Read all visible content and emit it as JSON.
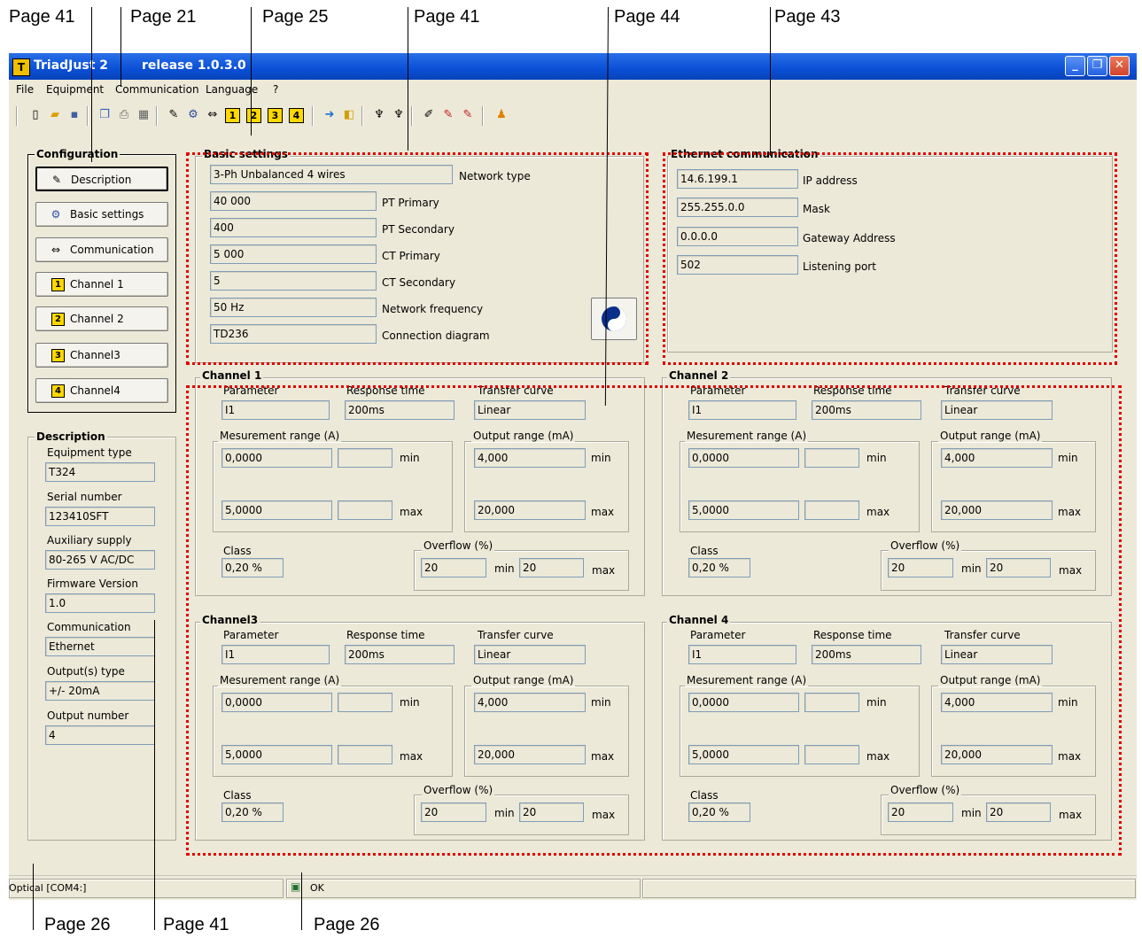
{
  "annotations": {
    "top": [
      "Page 41",
      "Page 21",
      "Page 25",
      "Page 41",
      "Page 44",
      "Page 43"
    ],
    "bottom": [
      "Page 26",
      "Page 41",
      "Page 26"
    ]
  },
  "window": {
    "title": "TriadJust 2",
    "release": "release 1.0.3.0",
    "minimize": "_",
    "restore": "❐",
    "close": "✕"
  },
  "menu": [
    "File",
    "Equipment",
    "Communication",
    "Language",
    "?"
  ],
  "toolbar": {
    "icons": [
      "new-file-icon",
      "open-folder-icon",
      "save-icon",
      "copy-icon",
      "print-icon",
      "print-preview-icon",
      "description-icon",
      "basic-settings-icon",
      "communication-icon",
      "channel-1-icon",
      "channel-2-icon",
      "channel-3-icon",
      "channel-4-icon",
      "download-icon",
      "upload-icon",
      "connect-icon",
      "disconnect-icon",
      "config-icon",
      "read-icon",
      "write-icon",
      "about-icon"
    ],
    "channel_numbers": [
      "1",
      "2",
      "3",
      "4"
    ]
  },
  "configuration": {
    "title": "Configuration",
    "buttons": [
      {
        "label": "Description",
        "icon": "description-icon"
      },
      {
        "label": "Basic settings",
        "icon": "gear-icon"
      },
      {
        "label": "Communication",
        "icon": "arrows-icon"
      },
      {
        "label": "Channel 1",
        "num": "1"
      },
      {
        "label": "Channel 2",
        "num": "2"
      },
      {
        "label": "Channel3",
        "num": "3"
      },
      {
        "label": "Channel4",
        "num": "4"
      }
    ]
  },
  "description": {
    "title": "Description",
    "items": [
      {
        "label": "Equipment type",
        "value": "T324"
      },
      {
        "label": "Serial number",
        "value": "123410SFT"
      },
      {
        "label": "Auxiliary supply",
        "value": "80-265 V AC/DC"
      },
      {
        "label": "Firmware Version",
        "value": "1.0"
      },
      {
        "label": "Communication",
        "value": "Ethernet"
      },
      {
        "label": "Output(s) type",
        "value": "+/- 20mA"
      },
      {
        "label": "Output number",
        "value": "4"
      }
    ]
  },
  "basic_settings": {
    "title": "Basic settings",
    "rows": [
      {
        "value": "3-Ph Unbalanced 4 wires",
        "label": "Network type"
      },
      {
        "value": "40 000",
        "label": "PT Primary"
      },
      {
        "value": "400",
        "label": "PT Secondary"
      },
      {
        "value": "5 000",
        "label": "CT Primary"
      },
      {
        "value": "5",
        "label": "CT Secondary"
      },
      {
        "value": "50 Hz",
        "label": "Network frequency"
      },
      {
        "value": "TD236",
        "label": "Connection diagram"
      }
    ],
    "help_icon": "help-icon"
  },
  "ethernet": {
    "title": "Ethernet communication",
    "rows": [
      {
        "value": "14.6.199.1",
        "label": "IP address"
      },
      {
        "value": "255.255.0.0",
        "label": "Mask"
      },
      {
        "value": "0.0.0.0",
        "label": "Gateway Address"
      },
      {
        "value": "502",
        "label": "Listening port"
      }
    ]
  },
  "channel_labels": {
    "parameter": "Parameter",
    "response_time": "Response time",
    "transfer_curve": "Transfer curve",
    "measurement_range": "Mesurement range (A)",
    "output_range": "Output range (mA)",
    "min": "min",
    "max": "max",
    "class": "Class",
    "overflow": "Overflow (%)"
  },
  "channels": [
    {
      "title": "Channel 1",
      "parameter": "I1",
      "response_time": "200ms",
      "transfer_curve": "Linear",
      "meas_min": "0,0000",
      "meas_max": "5,0000",
      "out_min": "4,000",
      "out_max": "20,000",
      "class": "0,20 %",
      "overflow_min": "20",
      "overflow_max": "20"
    },
    {
      "title": "Channel 2",
      "parameter": "I1",
      "response_time": "200ms",
      "transfer_curve": "Linear",
      "meas_min": "0,0000",
      "meas_max": "5,0000",
      "out_min": "4,000",
      "out_max": "20,000",
      "class": "0,20 %",
      "overflow_min": "20",
      "overflow_max": "20"
    },
    {
      "title": "Channel3",
      "parameter": "I1",
      "response_time": "200ms",
      "transfer_curve": "Linear",
      "meas_min": "0,0000",
      "meas_max": "5,0000",
      "out_min": "4,000",
      "out_max": "20,000",
      "class": "0,20 %",
      "overflow_min": "20",
      "overflow_max": "20"
    },
    {
      "title": "Channel 4",
      "parameter": "I1",
      "response_time": "200ms",
      "transfer_curve": "Linear",
      "meas_min": "0,0000",
      "meas_max": "5,0000",
      "out_min": "4,000",
      "out_max": "20,000",
      "class": "0,20 %",
      "overflow_min": "20",
      "overflow_max": "20"
    }
  ],
  "statusbar": {
    "port": "Optical [COM4:]",
    "status": "OK",
    "status_icon": "connection-icon"
  },
  "colors": {
    "highlight": "#e00000",
    "titlebar": "#0a4fd6",
    "window_bg": "#ece9d8",
    "number_badge": "#ffd800"
  }
}
